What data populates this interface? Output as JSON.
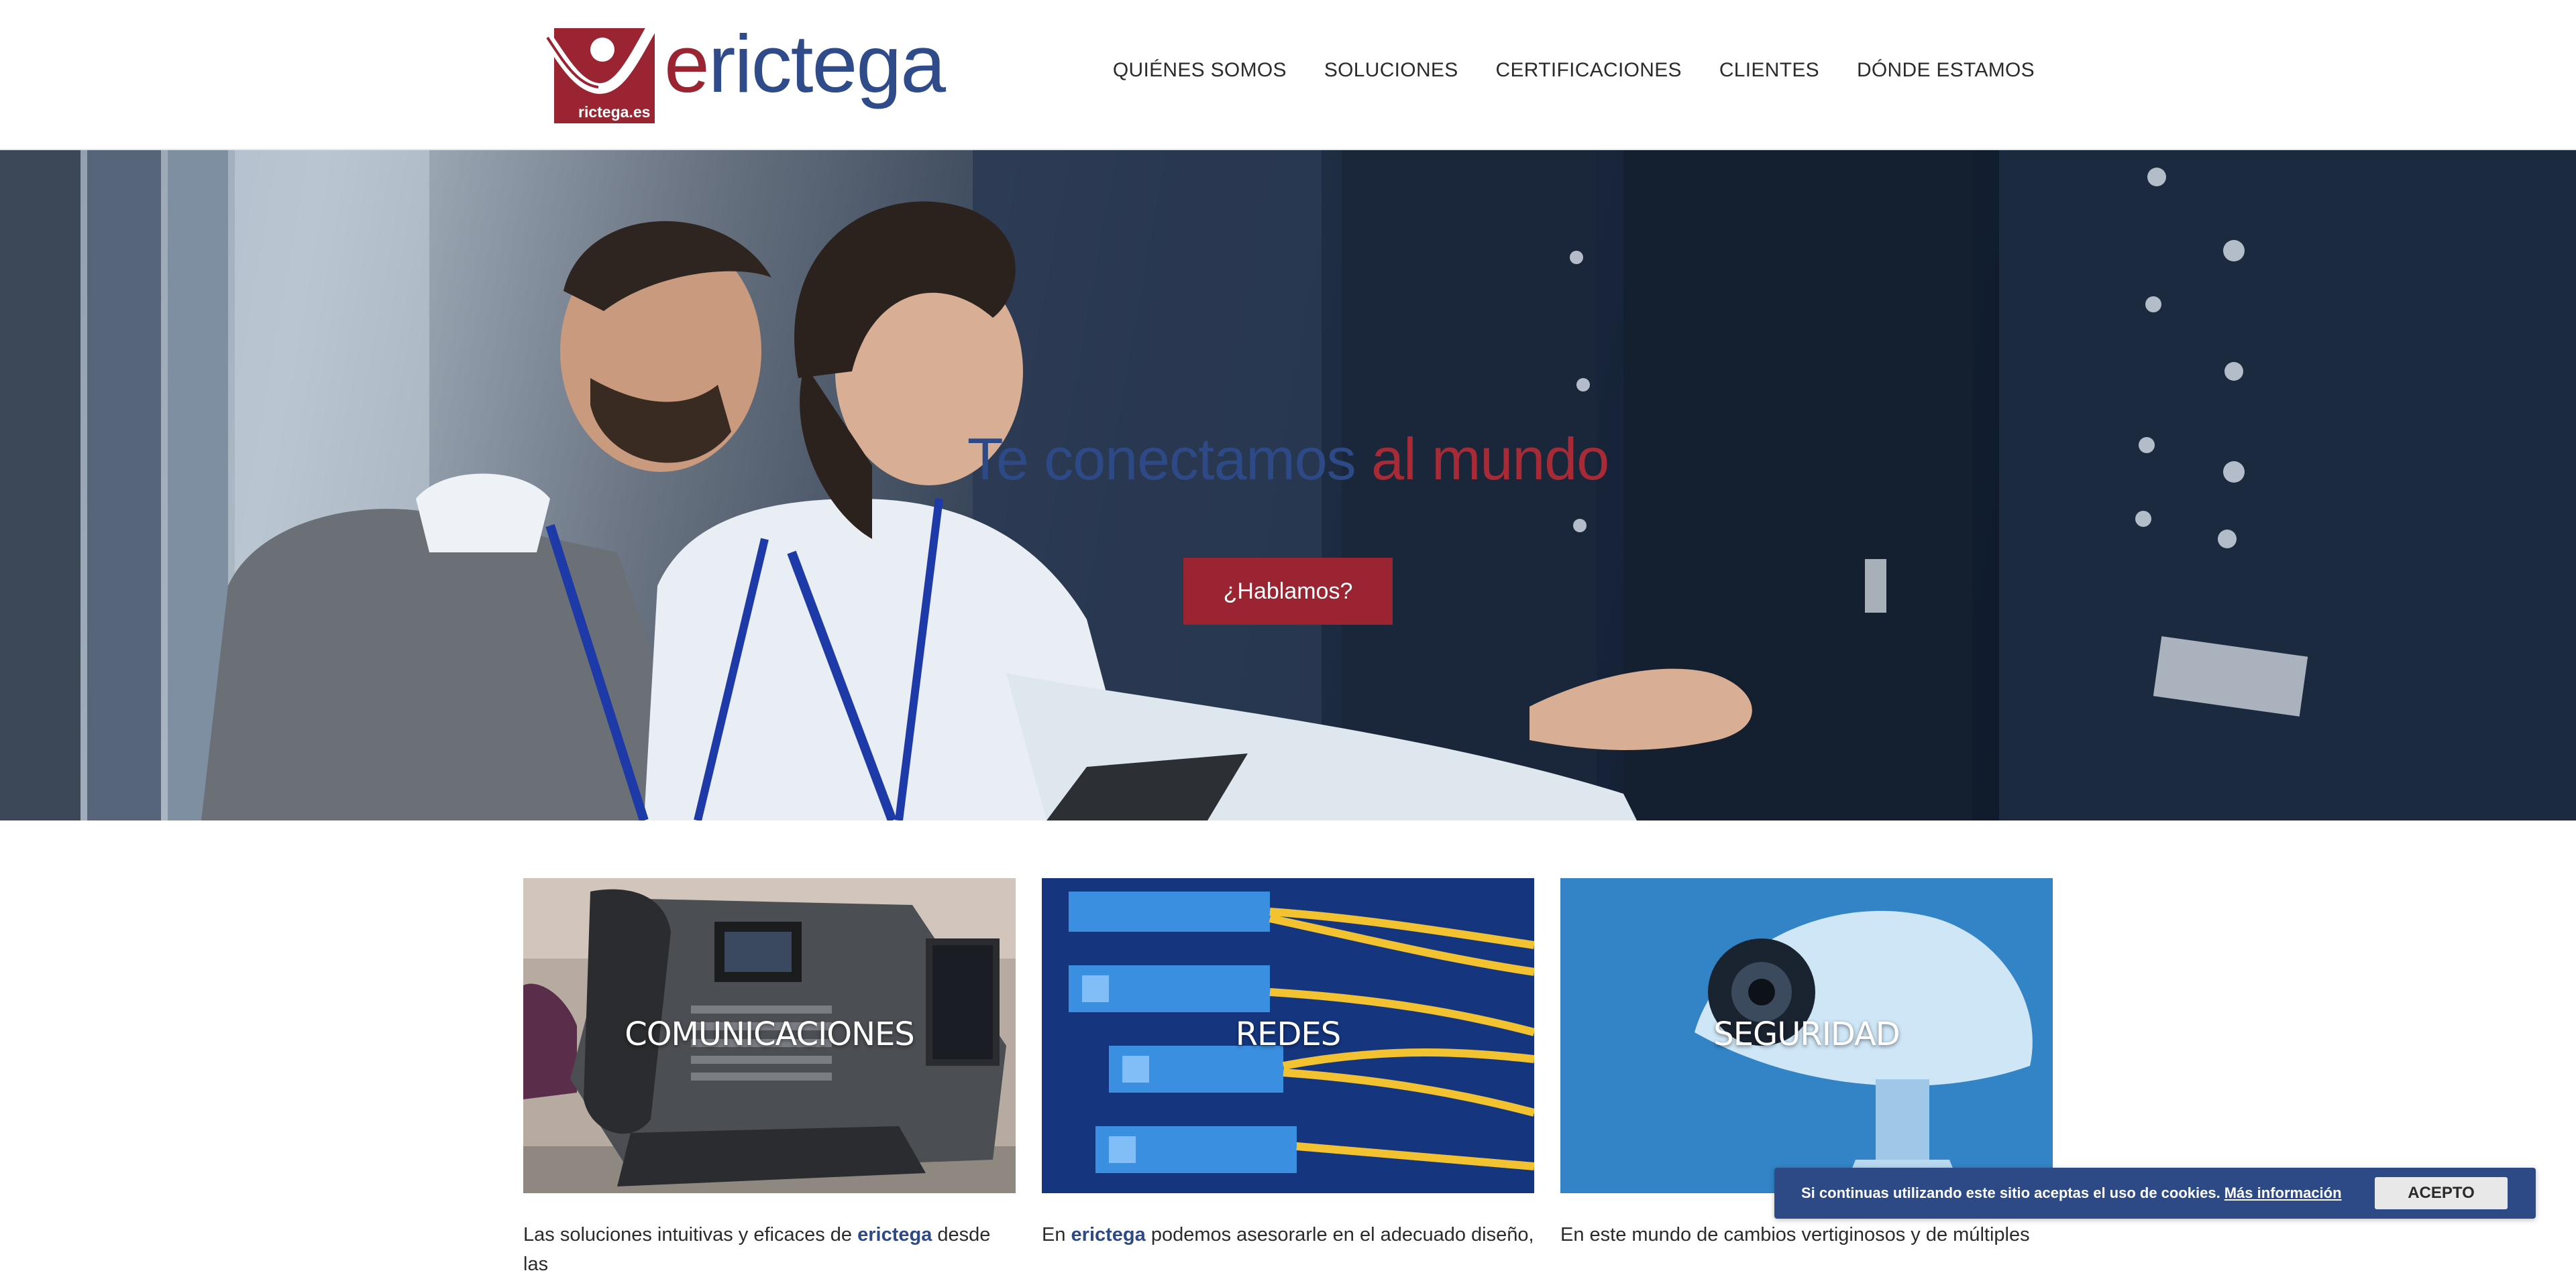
{
  "brand": {
    "logo_word_first": "e",
    "logo_word_rest": "rictega",
    "logo_domain": "rictega.es",
    "colors": {
      "blue": "#2e4a86",
      "red": "#9a2431"
    }
  },
  "nav": {
    "items": [
      {
        "label": "QUIÉNES SOMOS"
      },
      {
        "label": "SOLUCIONES"
      },
      {
        "label": "CERTIFICACIONES"
      },
      {
        "label": "CLIENTES"
      },
      {
        "label": "DÓNDE ESTAMOS"
      }
    ]
  },
  "hero": {
    "title_blue": "Te conectamos",
    "title_red": "al mundo",
    "cta_label": "¿Hablamos?"
  },
  "cards": [
    {
      "title": "COMUNICACIONES"
    },
    {
      "title": "REDES"
    },
    {
      "title": "SEGURIDAD"
    }
  ],
  "descriptions": [
    {
      "before": "Las soluciones intuitivas y eficaces de ",
      "brand_first": "e",
      "brand_rest": "rictega",
      "after": " desde las"
    },
    {
      "before": "En ",
      "brand_first": "",
      "brand_rest": "erictega",
      "after": " podemos asesorarle en el adecuado diseño,"
    },
    {
      "before": "En este mundo de cambios vertiginosos y de múltiples",
      "brand_first": "",
      "brand_rest": "",
      "after": ""
    }
  ],
  "cookie": {
    "text": "Si continuas utilizando este sitio aceptas el uso de cookies.",
    "link": "Más información",
    "button": "ACEPTO"
  }
}
